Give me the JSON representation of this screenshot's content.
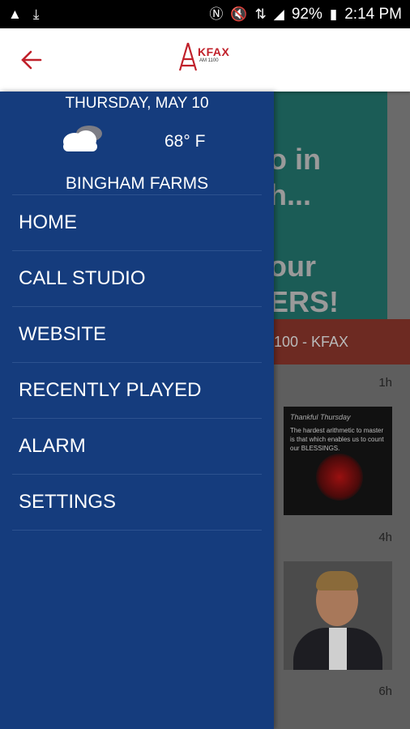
{
  "status_bar": {
    "battery": "92%",
    "time": "2:14 PM",
    "icons": [
      "warning-icon",
      "download-icon",
      "nfc-icon",
      "mute-icon",
      "data-icon",
      "signal-icon",
      "battery-icon"
    ]
  },
  "app_bar": {
    "back_icon": "arrow-back-icon",
    "logo_text": "KFAX",
    "logo_sub": "AM 1100"
  },
  "drawer": {
    "date": "THURSDAY, MAY 10",
    "weather_icon": "cloud-icon",
    "temperature": "68° F",
    "city": "BINGHAM FARMS",
    "menu": [
      {
        "label": "HOME"
      },
      {
        "label": "CALL STUDIO"
      },
      {
        "label": "WEBSITE"
      },
      {
        "label": "RECENTLY PLAYED"
      },
      {
        "label": "ALARM"
      },
      {
        "label": "SETTINGS"
      }
    ]
  },
  "background": {
    "banner_lines": [
      "o in",
      "h...",
      "",
      "our",
      "ERS!"
    ],
    "station_bar": "100 - KFAX",
    "feed": [
      {
        "time": "1h",
        "title": "Thankful Thursday",
        "quote": "The hardest arithmetic to master is that which enables us to count our BLESSINGS."
      },
      {
        "time": "4h"
      },
      {
        "time": "6h"
      }
    ]
  },
  "colors": {
    "drawer": "#153c7d",
    "accent_red": "#c0202a",
    "divider": "#2d528f"
  }
}
